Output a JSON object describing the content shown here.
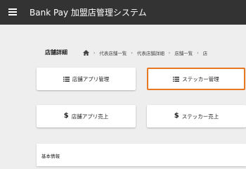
{
  "header": {
    "title": "Bank Pay 加盟店管理システム"
  },
  "page": {
    "title": "店舗詳細"
  },
  "breadcrumb": {
    "items": [
      "代表店舗一覧",
      "代表店舗詳細",
      "店舗一覧",
      "店"
    ]
  },
  "actions": {
    "app_mgmt": "店舗アプリ管理",
    "sticker_mgmt": "ステッカー管理",
    "app_sales": "店舗アプリ売上",
    "sticker_sales": "ステッカー売上",
    "dollar_symbol": "$"
  },
  "section": {
    "basic_info": "基本情報"
  },
  "colors": {
    "appbar": "#333333",
    "highlight": "#e87722",
    "background": "#eeeeee"
  },
  "icons": {
    "menu": "hamburger-icon",
    "home": "home-icon",
    "list": "list-icon",
    "dollar": "dollar-icon"
  }
}
